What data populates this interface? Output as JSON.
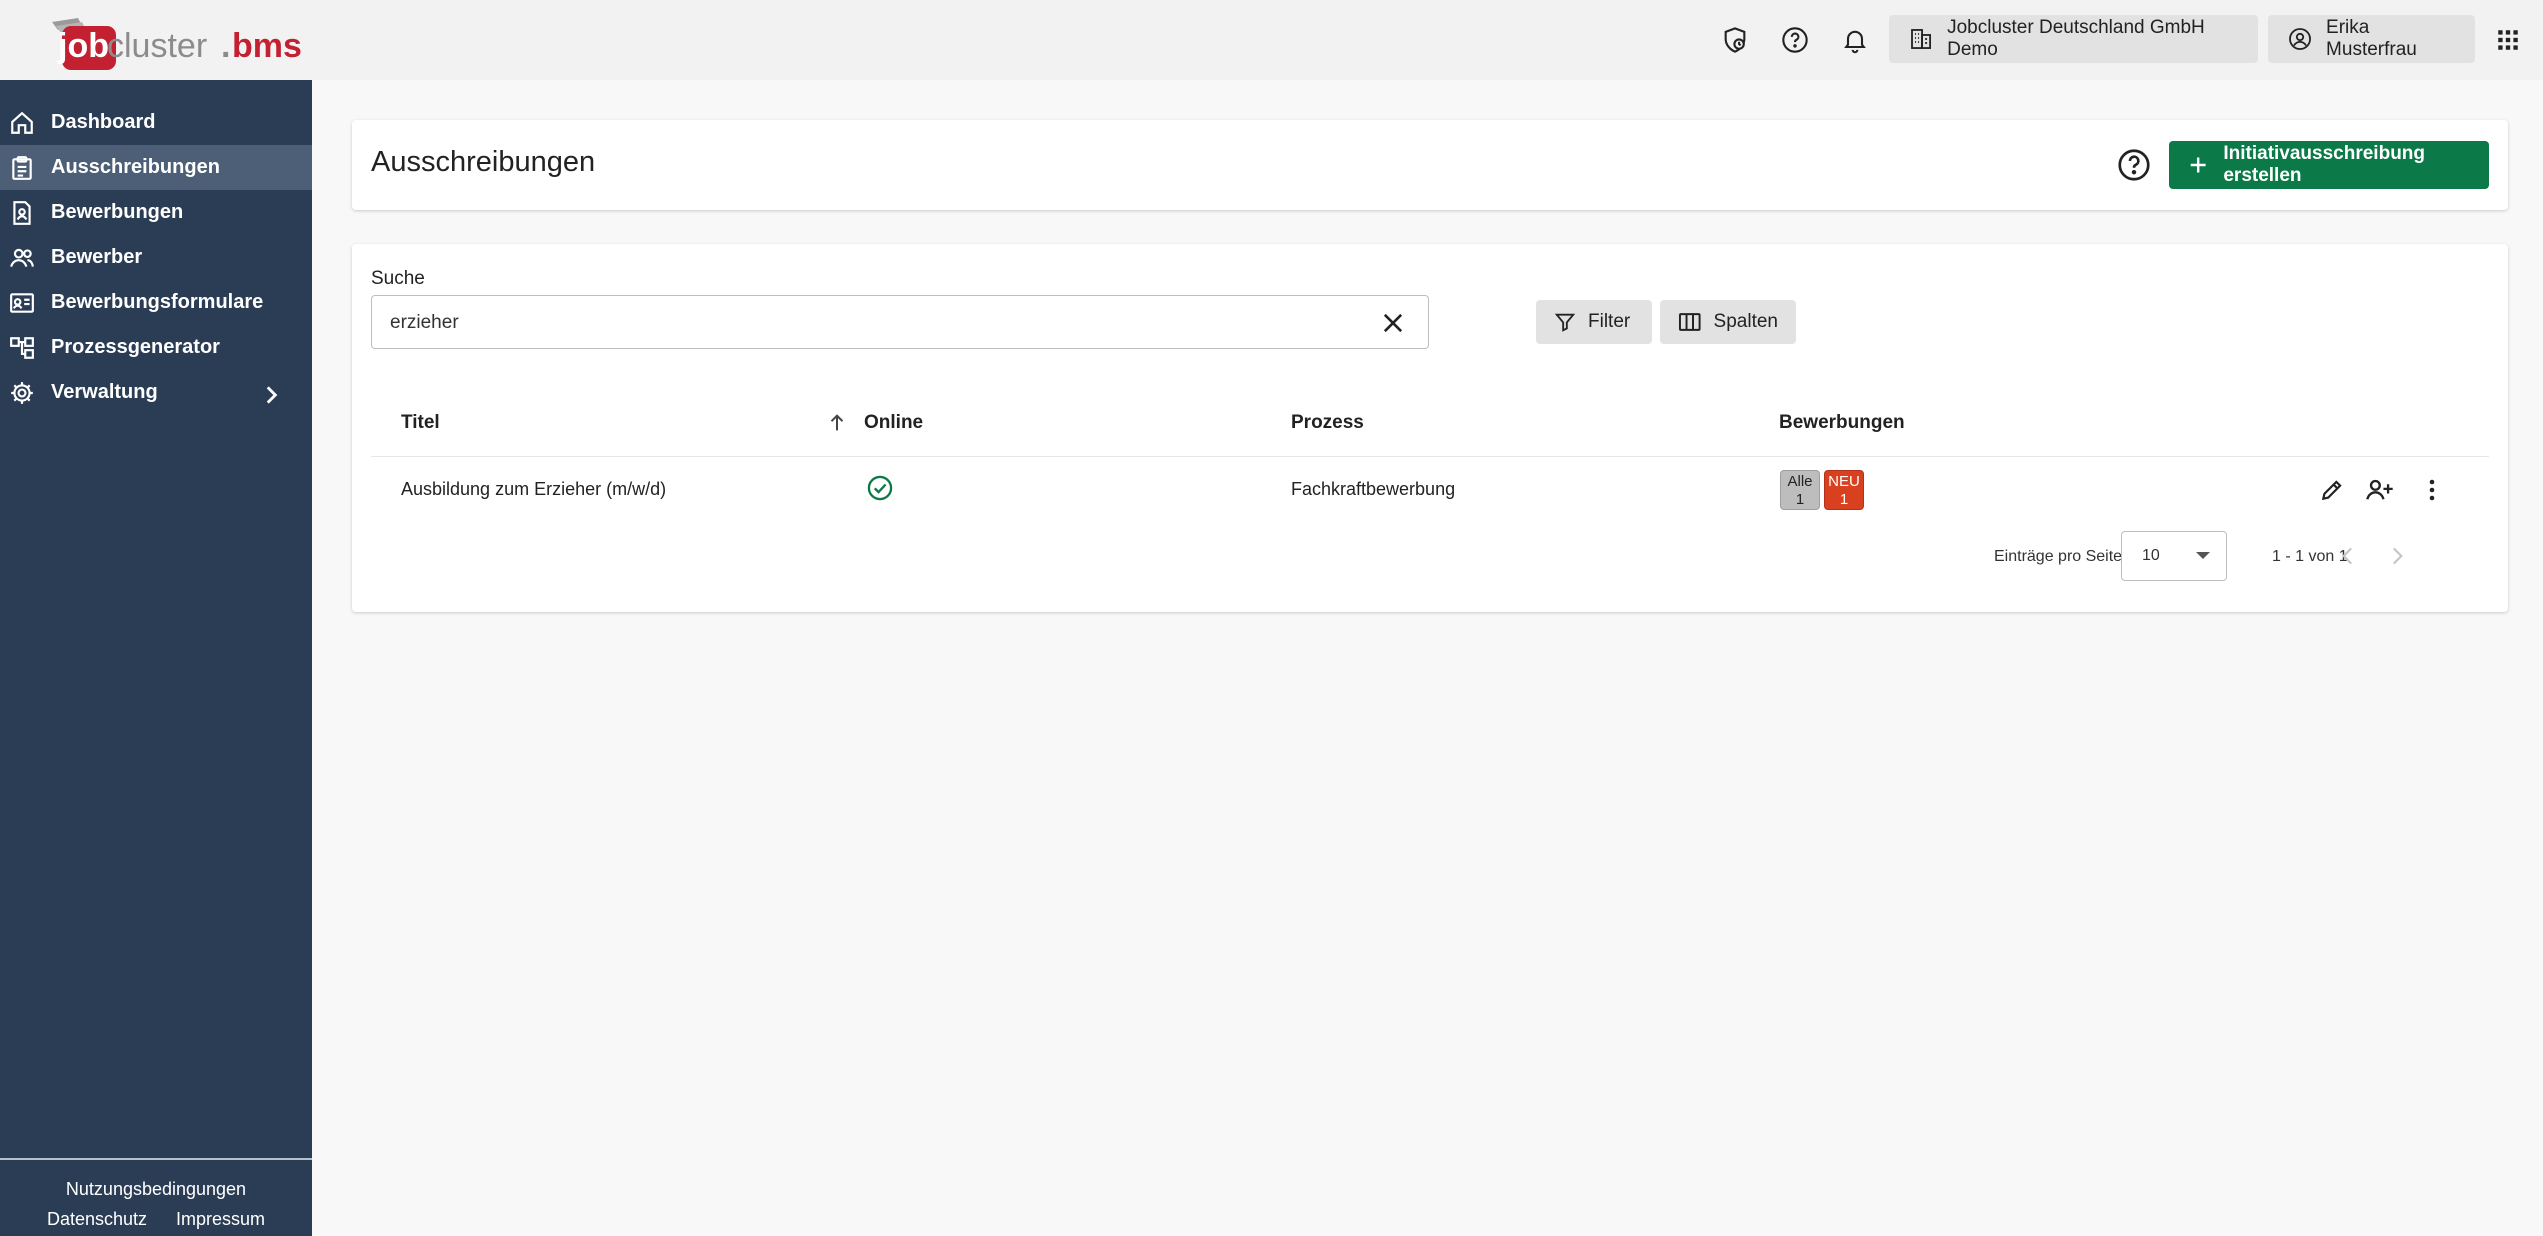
{
  "brand": {
    "logo_parts": [
      "job",
      "cluster",
      ".",
      "bms"
    ],
    "colors": {
      "red": "#c32032",
      "grey": "#8c8c8c",
      "sidebar": "#2b3d55",
      "primary": "#0b7a48",
      "badge_new": "#d9401f"
    }
  },
  "topbar": {
    "icons": [
      "shield-clock-icon",
      "help-icon",
      "bell-icon",
      "apps-grid-icon"
    ],
    "company_button": "Jobcluster Deutschland GmbH Demo",
    "user_button": "Erika Musterfrau"
  },
  "sidebar": {
    "items": [
      {
        "label": "Dashboard",
        "icon": "home-icon",
        "active": false
      },
      {
        "label": "Ausschreibungen",
        "icon": "clipboard-icon",
        "active": true
      },
      {
        "label": "Bewerbungen",
        "icon": "document-person-icon",
        "active": false
      },
      {
        "label": "Bewerber",
        "icon": "people-icon",
        "active": false
      },
      {
        "label": "Bewerbungsformulare",
        "icon": "id-card-icon",
        "active": false
      },
      {
        "label": "Prozessgenerator",
        "icon": "process-icon",
        "active": false
      },
      {
        "label": "Verwaltung",
        "icon": "gear-icon",
        "active": false
      }
    ],
    "footer": {
      "terms": "Nutzungsbedingungen",
      "privacy": "Datenschutz",
      "imprint": "Impressum"
    }
  },
  "header": {
    "title": "Ausschreibungen",
    "create_button": "Initiativausschreibung erstellen"
  },
  "search": {
    "label": "Suche",
    "value": "erzieher"
  },
  "toolbar": {
    "filter_label": "Filter",
    "columns_label": "Spalten"
  },
  "table": {
    "columns": [
      "Titel",
      "Online",
      "Prozess",
      "Bewerbungen"
    ],
    "sort": {
      "column": "Titel",
      "direction": "asc"
    },
    "rows": [
      {
        "title": "Ausbildung zum Erzieher (m/w/d)",
        "online": true,
        "process": "Fachkraftbewerbung",
        "badges": {
          "all_label": "Alle",
          "all_count": "1",
          "new_label": "NEU",
          "new_count": "1"
        }
      }
    ]
  },
  "pagination": {
    "per_page_label": "Einträge pro Seite",
    "per_page_value": "10",
    "range_text": "1 - 1 von 1"
  }
}
